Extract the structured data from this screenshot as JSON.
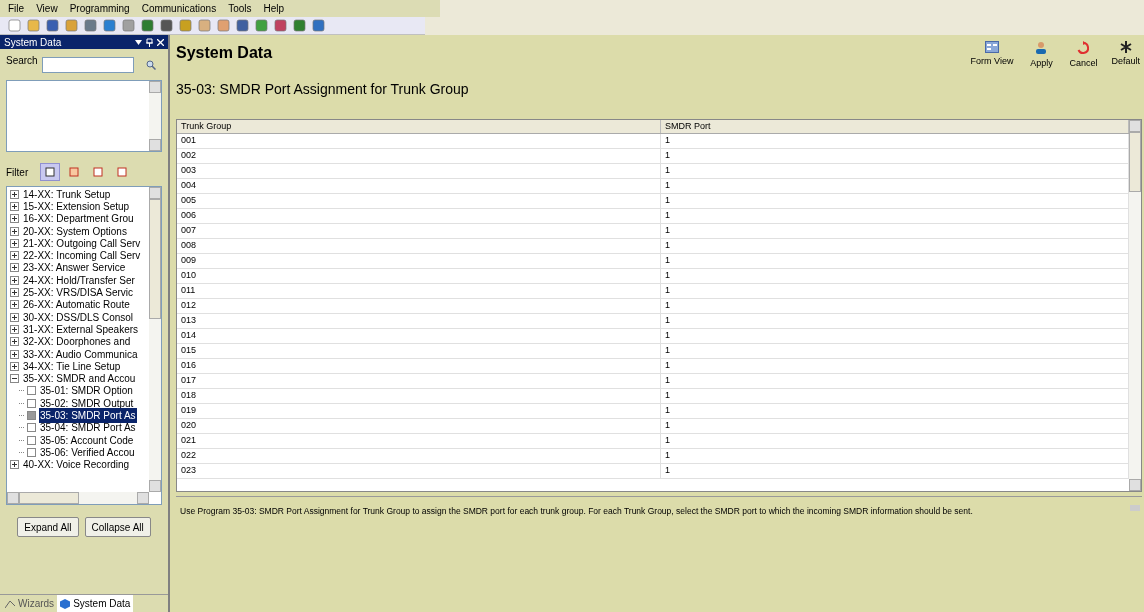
{
  "menu": [
    "File",
    "View",
    "Programming",
    "Communications",
    "Tools",
    "Help"
  ],
  "panel": {
    "title": "System Data",
    "search_label": "Search",
    "filter_label": "Filter",
    "filters": [
      {
        "selected": true
      },
      {
        "selected": false
      },
      {
        "selected": false
      },
      {
        "selected": false
      }
    ],
    "tree": [
      {
        "label": "14-XX: Trunk Setup",
        "expanded": false
      },
      {
        "label": "15-XX: Extension Setup",
        "expanded": false
      },
      {
        "label": "16-XX: Department Grou",
        "expanded": false
      },
      {
        "label": "20-XX: System Options",
        "expanded": false
      },
      {
        "label": "21-XX: Outgoing Call Serv",
        "expanded": false
      },
      {
        "label": "22-XX: Incoming Call Serv",
        "expanded": false
      },
      {
        "label": "23-XX: Answer Service",
        "expanded": false
      },
      {
        "label": "24-XX: Hold/Transfer Ser",
        "expanded": false
      },
      {
        "label": "25-XX: VRS/DISA Servic",
        "expanded": false
      },
      {
        "label": "26-XX: Automatic Route",
        "expanded": false
      },
      {
        "label": "30-XX: DSS/DLS Consol",
        "expanded": false
      },
      {
        "label": "31-XX: External Speakers",
        "expanded": false
      },
      {
        "label": "32-XX: Doorphones and",
        "expanded": false
      },
      {
        "label": "33-XX: Audio Communica",
        "expanded": false
      },
      {
        "label": "34-XX: Tie Line Setup",
        "expanded": false
      },
      {
        "label": "35-XX: SMDR and Accou",
        "expanded": true,
        "children": [
          {
            "label": "35-01: SMDR Option",
            "selected": false
          },
          {
            "label": "35-02: SMDR Output",
            "selected": false
          },
          {
            "label": "35-03: SMDR Port As",
            "selected": true
          },
          {
            "label": "35-04: SMDR Port As",
            "selected": false
          },
          {
            "label": "35-05: Account Code",
            "selected": false
          },
          {
            "label": "35-06: Verified Accou",
            "selected": false
          }
        ]
      },
      {
        "label": "40-XX: Voice Recording",
        "expanded": false
      }
    ],
    "buttons": [
      "Expand All",
      "Collapse All"
    ],
    "tabs": [
      {
        "label": "Wizards",
        "selected": false
      },
      {
        "label": "System Data",
        "selected": true
      }
    ]
  },
  "main": {
    "title": "System Data",
    "actions": [
      {
        "kind": "form",
        "label": "Form View"
      },
      {
        "kind": "apply",
        "label": "Apply"
      },
      {
        "kind": "cancel",
        "label": "Cancel"
      },
      {
        "kind": "default",
        "label": "Default"
      }
    ],
    "subtitle": "35-03: SMDR Port Assignment for Trunk Group",
    "table": {
      "columns": [
        "Trunk Group",
        "SMDR Port"
      ],
      "rows": [
        [
          "001",
          "1"
        ],
        [
          "002",
          "1"
        ],
        [
          "003",
          "1"
        ],
        [
          "004",
          "1"
        ],
        [
          "005",
          "1"
        ],
        [
          "006",
          "1"
        ],
        [
          "007",
          "1"
        ],
        [
          "008",
          "1"
        ],
        [
          "009",
          "1"
        ],
        [
          "010",
          "1"
        ],
        [
          "011",
          "1"
        ],
        [
          "012",
          "1"
        ],
        [
          "013",
          "1"
        ],
        [
          "014",
          "1"
        ],
        [
          "015",
          "1"
        ],
        [
          "016",
          "1"
        ],
        [
          "017",
          "1"
        ],
        [
          "018",
          "1"
        ],
        [
          "019",
          "1"
        ],
        [
          "020",
          "1"
        ],
        [
          "021",
          "1"
        ],
        [
          "022",
          "1"
        ],
        [
          "023",
          "1"
        ]
      ]
    },
    "description": "Use Program 35-03: SMDR Port Assignment for Trunk Group to assign the SMDR port for each trunk group. For each Trunk Group, select the SMDR port to which the incoming SMDR information should be sent."
  }
}
